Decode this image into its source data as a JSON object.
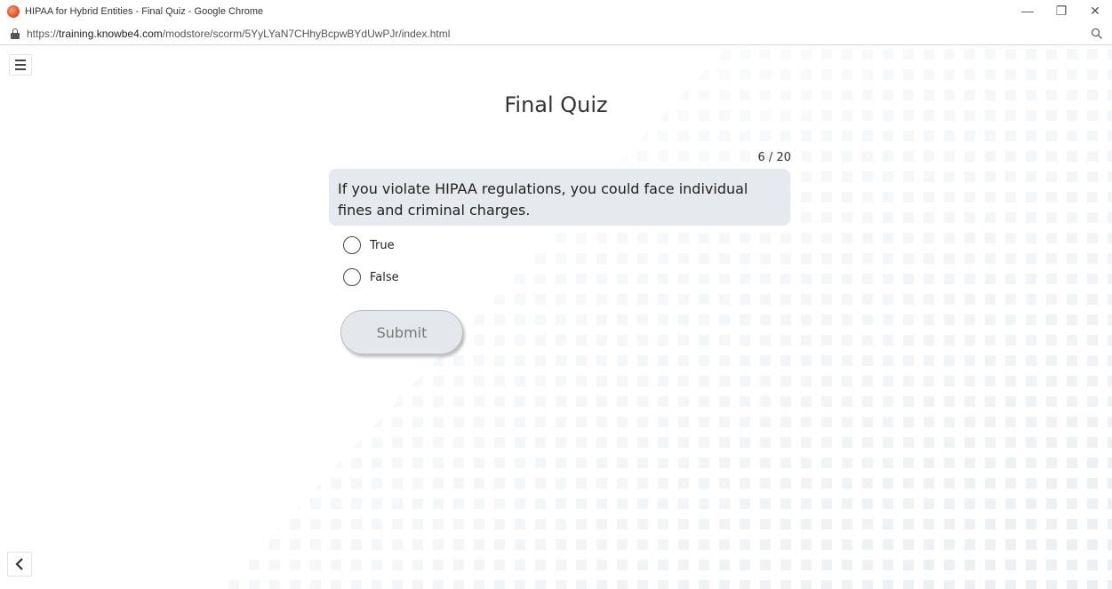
{
  "browser": {
    "window_title": "HIPAA for Hybrid Entities - Final Quiz - Google Chrome",
    "url_prefix": "https://",
    "url_host": "training.knowbe4.com",
    "url_path": "/modstore/scorm/5YyLYaN7CHhyBcpwBYdUwPJr/index.html",
    "controls": {
      "minimize": "—",
      "restore": "❐",
      "close": "✕"
    }
  },
  "quiz": {
    "title": "Final Quiz",
    "counter": "6 / 20",
    "question": "If you violate HIPAA regulations, you could face individual fines and criminal charges.",
    "options": [
      {
        "label": "True",
        "selected": false
      },
      {
        "label": "False",
        "selected": false
      }
    ],
    "submit_label": "Submit"
  },
  "icons": {
    "menu": "hamburger-icon",
    "back": "chevron-left-icon",
    "lock": "lock-icon",
    "zoom": "magnifier-icon"
  },
  "colors": {
    "question_bg": "#e6e9ed",
    "submit_bg": "#e4e7eb",
    "favicon": "#e8562b"
  }
}
